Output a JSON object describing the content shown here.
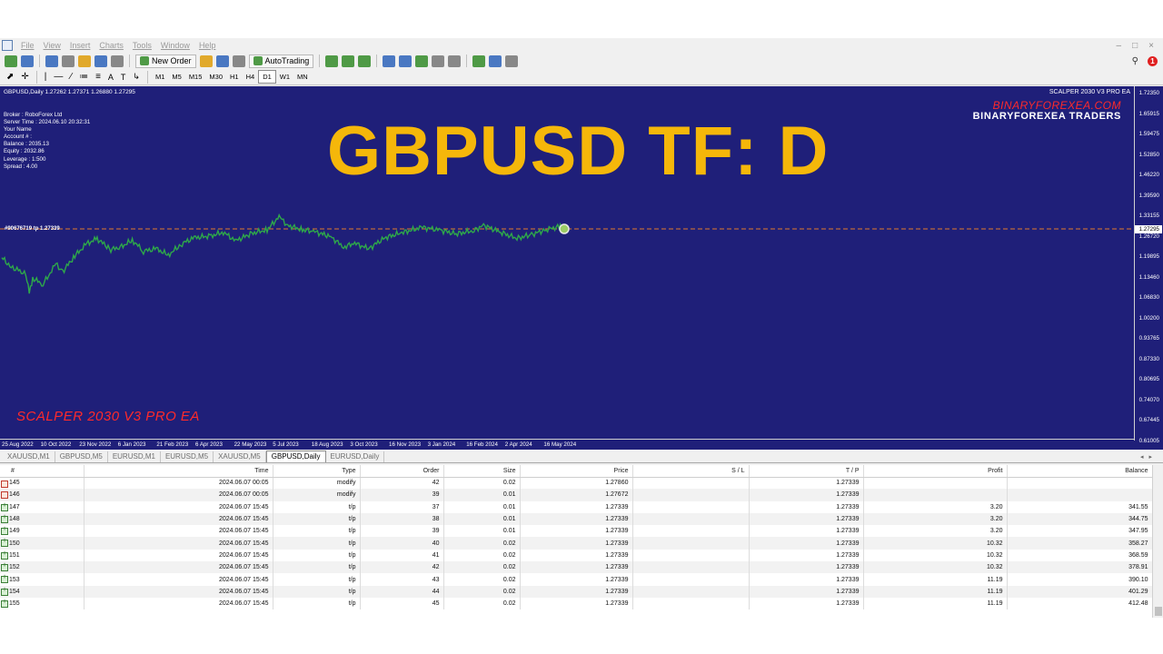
{
  "menu": [
    "File",
    "View",
    "Insert",
    "Charts",
    "Tools",
    "Window",
    "Help"
  ],
  "toolbar": {
    "new_order": "New Order",
    "autotrading": "AutoTrading",
    "alert_count": "1",
    "timeframes": [
      "M1",
      "M5",
      "M15",
      "M30",
      "H1",
      "H4",
      "D1",
      "W1",
      "MN"
    ],
    "active_timeframe": "D1"
  },
  "chart": {
    "header": "GBPUSD,Daily  1.27262 1.27371 1.26880 1.27295",
    "ea_name": "SCALPER 2030 V3 PRO EA",
    "title": "GBPUSD TF: D",
    "brand_url": "BINARYFOREXEA.COM",
    "brand_name": "BINARYFOREXEA TRADERS",
    "watermark": "SCALPER 2030 V3 PRO EA",
    "trade_labels": "#90676719 tp 1.27339",
    "current_price": "1.27295",
    "info_lines": [
      "Broker  : RoboForex Ltd",
      "Server Time : 2024.06.10 20:32:31",
      "Your Name",
      "Account # :",
      "Balance : 2035.13",
      "Equity    : 2032.86",
      "Leverage : 1:500",
      "Spread : 4.00"
    ]
  },
  "chart_data": {
    "type": "line",
    "title": "GBPUSD TF: D",
    "y_ticks": [
      "1.72350",
      "1.65915",
      "1.59475",
      "1.52850",
      "1.46220",
      "1.39590",
      "1.33155",
      "1.26720",
      "1.19895",
      "1.13460",
      "1.06830",
      "1.00200",
      "0.93765",
      "0.87330",
      "0.80695",
      "0.74070",
      "0.67445",
      "0.61005"
    ],
    "x_ticks": [
      "25 Aug 2022",
      "10 Oct 2022",
      "23 Nov 2022",
      "6 Jan 2023",
      "21 Feb 2023",
      "6 Apr 2023",
      "22 May 2023",
      "5 Jul 2023",
      "18 Aug 2023",
      "3 Oct 2023",
      "16 Nov 2023",
      "3 Jan 2024",
      "16 Feb 2024",
      "2 Apr 2024",
      "16 May 2024"
    ],
    "ylim": [
      0.61005,
      1.7235
    ],
    "xlim": [
      "2022-08-25",
      "2024-06-10"
    ],
    "series": [
      {
        "color": "#2ea84a",
        "points": [
          [
            "2022-08-25",
            1.182
          ],
          [
            "2022-09-05",
            1.152
          ],
          [
            "2022-09-15",
            1.141
          ],
          [
            "2022-09-22",
            1.127
          ],
          [
            "2022-09-26",
            1.069
          ],
          [
            "2022-09-30",
            1.117
          ],
          [
            "2022-10-12",
            1.098
          ],
          [
            "2022-10-27",
            1.162
          ],
          [
            "2022-11-04",
            1.138
          ],
          [
            "2022-11-18",
            1.188
          ],
          [
            "2022-12-02",
            1.226
          ],
          [
            "2022-12-14",
            1.242
          ],
          [
            "2022-12-30",
            1.208
          ],
          [
            "2023-01-10",
            1.215
          ],
          [
            "2023-01-24",
            1.237
          ],
          [
            "2023-02-06",
            1.203
          ],
          [
            "2023-02-21",
            1.21
          ],
          [
            "2023-03-07",
            1.19
          ],
          [
            "2023-03-23",
            1.227
          ],
          [
            "2023-04-06",
            1.245
          ],
          [
            "2023-04-26",
            1.251
          ],
          [
            "2023-05-10",
            1.263
          ],
          [
            "2023-05-24",
            1.235
          ],
          [
            "2023-06-12",
            1.259
          ],
          [
            "2023-06-30",
            1.27
          ],
          [
            "2023-07-14",
            1.312
          ],
          [
            "2023-07-24",
            1.284
          ],
          [
            "2023-08-10",
            1.27
          ],
          [
            "2023-08-23",
            1.265
          ],
          [
            "2023-09-12",
            1.249
          ],
          [
            "2023-09-27",
            1.215
          ],
          [
            "2023-10-10",
            1.228
          ],
          [
            "2023-10-26",
            1.21
          ],
          [
            "2023-11-14",
            1.245
          ],
          [
            "2023-12-04",
            1.261
          ],
          [
            "2023-12-28",
            1.278
          ],
          [
            "2024-01-18",
            1.269
          ],
          [
            "2024-02-05",
            1.257
          ],
          [
            "2024-02-26",
            1.268
          ],
          [
            "2024-03-08",
            1.285
          ],
          [
            "2024-03-28",
            1.262
          ],
          [
            "2024-04-16",
            1.243
          ],
          [
            "2024-05-03",
            1.255
          ],
          [
            "2024-05-20",
            1.271
          ],
          [
            "2024-06-04",
            1.28
          ],
          [
            "2024-06-10",
            1.273
          ]
        ]
      }
    ],
    "price_line": 1.27295,
    "grid": false
  },
  "chart_tabs": [
    "XAUUSD,M1",
    "GBPUSD,M5",
    "EURUSD,M1",
    "EURUSD,M5",
    "XAUUSD,M5",
    "GBPUSD,Daily",
    "EURUSD,Daily"
  ],
  "active_chart_tab": "GBPUSD,Daily",
  "history": {
    "columns": [
      "#",
      "Time",
      "Type",
      "Order",
      "Size",
      "Price",
      "S / L",
      "T / P",
      "Profit",
      "Balance"
    ],
    "rows": [
      {
        "kind": "modify",
        "cells": [
          "145",
          "2024.06.07 00:05",
          "modify",
          "42",
          "0.02",
          "1.27860",
          "",
          "1.27339",
          "",
          ""
        ]
      },
      {
        "kind": "modify",
        "cells": [
          "146",
          "2024.06.07 00:05",
          "modify",
          "39",
          "0.01",
          "1.27672",
          "",
          "1.27339",
          "",
          ""
        ]
      },
      {
        "kind": "close",
        "cells": [
          "147",
          "2024.06.07 15:45",
          "t/p",
          "37",
          "0.01",
          "1.27339",
          "",
          "1.27339",
          "3.20",
          "341.55"
        ]
      },
      {
        "kind": "close",
        "cells": [
          "148",
          "2024.06.07 15:45",
          "t/p",
          "38",
          "0.01",
          "1.27339",
          "",
          "1.27339",
          "3.20",
          "344.75"
        ]
      },
      {
        "kind": "close",
        "cells": [
          "149",
          "2024.06.07 15:45",
          "t/p",
          "39",
          "0.01",
          "1.27339",
          "",
          "1.27339",
          "3.20",
          "347.95"
        ]
      },
      {
        "kind": "close",
        "cells": [
          "150",
          "2024.06.07 15:45",
          "t/p",
          "40",
          "0.02",
          "1.27339",
          "",
          "1.27339",
          "10.32",
          "358.27"
        ]
      },
      {
        "kind": "close",
        "cells": [
          "151",
          "2024.06.07 15:45",
          "t/p",
          "41",
          "0.02",
          "1.27339",
          "",
          "1.27339",
          "10.32",
          "368.59"
        ]
      },
      {
        "kind": "close",
        "cells": [
          "152",
          "2024.06.07 15:45",
          "t/p",
          "42",
          "0.02",
          "1.27339",
          "",
          "1.27339",
          "10.32",
          "378.91"
        ]
      },
      {
        "kind": "close",
        "cells": [
          "153",
          "2024.06.07 15:45",
          "t/p",
          "43",
          "0.02",
          "1.27339",
          "",
          "1.27339",
          "11.19",
          "390.10"
        ]
      },
      {
        "kind": "close",
        "cells": [
          "154",
          "2024.06.07 15:45",
          "t/p",
          "44",
          "0.02",
          "1.27339",
          "",
          "1.27339",
          "11.19",
          "401.29"
        ]
      },
      {
        "kind": "close",
        "cells": [
          "155",
          "2024.06.07 15:45",
          "t/p",
          "45",
          "0.02",
          "1.27339",
          "",
          "1.27339",
          "11.19",
          "412.48"
        ]
      }
    ]
  }
}
